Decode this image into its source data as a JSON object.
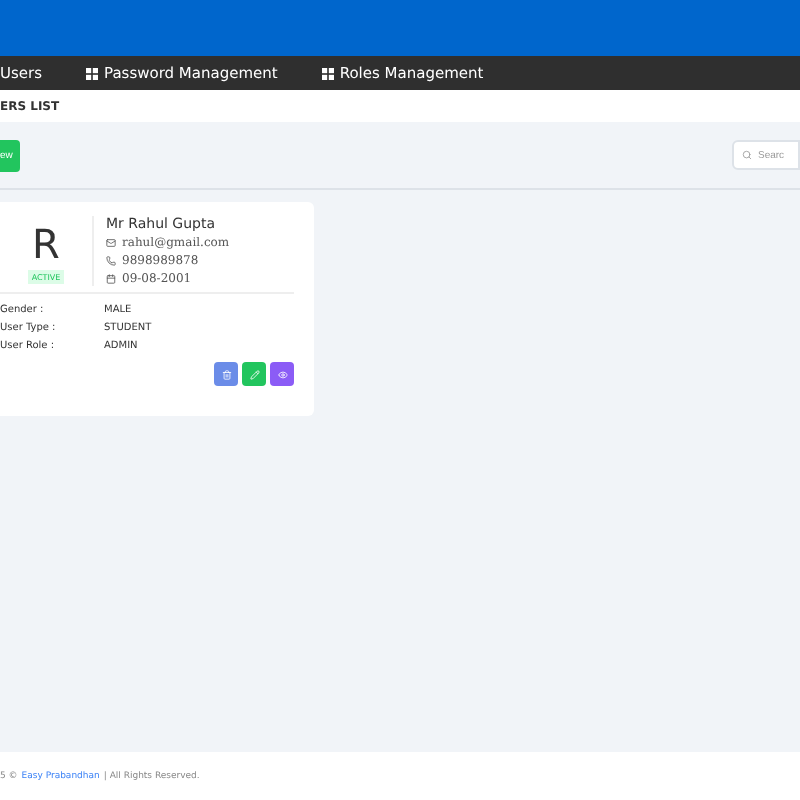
{
  "nav": {
    "items": [
      {
        "label": "Users",
        "icon": false
      },
      {
        "label": "Password Management",
        "icon": true
      },
      {
        "label": "Roles Management",
        "icon": true
      }
    ]
  },
  "page_title": "ERS LIST",
  "toolbar": {
    "add_button": "ew",
    "search": {
      "placeholder": "Searc"
    }
  },
  "users": [
    {
      "initial": "R",
      "status": "ACTIVE",
      "active": true,
      "name": "Mr Rahul Gupta",
      "email": "rahul@gmail.com",
      "phone": "9898989878",
      "dob": "09-08-2001",
      "fields": [
        {
          "label": "Gender :",
          "value": "MALE"
        },
        {
          "label": "User Type :",
          "value": "STUDENT"
        },
        {
          "label": "User Role :",
          "value": "ADMIN"
        }
      ]
    }
  ],
  "footer": {
    "prefix": "5 ©",
    "link": "Easy Prabandhan",
    "suffix": "| All Rights Reserved."
  }
}
